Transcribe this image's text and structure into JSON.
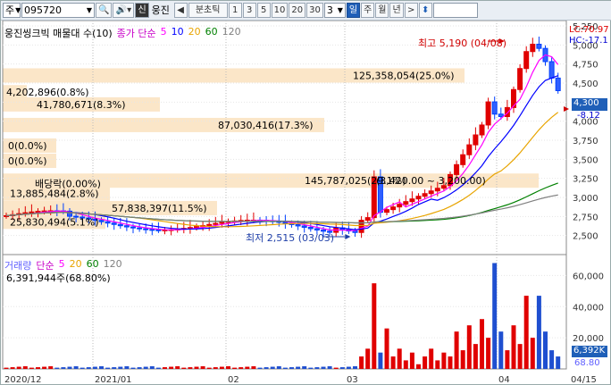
{
  "toolbar": {
    "market": "주",
    "code": "095720",
    "search_icon": "search-icon",
    "speaker_icon": "speaker-icon",
    "credit_badge": "신",
    "stock_name": "웅진",
    "interval_label": "분초틱",
    "intervals": [
      "1",
      "3",
      "5",
      "10",
      "20",
      "30"
    ],
    "count_value": "3",
    "periods": [
      "일",
      "주",
      "월",
      "년"
    ],
    "next_arrow": ">",
    "updown_icon": "up-down-icon"
  },
  "price_legend": {
    "series_title": "웅진씽크빅 매물대 수(10)",
    "ma_title": "종가 단순",
    "periods": [
      {
        "label": "5",
        "color": "#ff00ff"
      },
      {
        "label": "10",
        "color": "#0000ff"
      },
      {
        "label": "20",
        "color": "#e8a400"
      },
      {
        "label": "60",
        "color": "#008000"
      },
      {
        "label": "120",
        "color": "#808080"
      }
    ]
  },
  "volume_legend": {
    "title": "거래량",
    "ma_title": "단순",
    "periods": [
      {
        "label": "5",
        "color": "#ff00ff"
      },
      {
        "label": "20",
        "color": "#e8a400"
      },
      {
        "label": "60",
        "color": "#008000"
      },
      {
        "label": "120",
        "color": "#808080"
      }
    ],
    "max_volume_label": "6,391,944주(68.80%)"
  },
  "right_panel": {
    "lc_label": "LC:70.97",
    "hc_label": "HC:-17.1",
    "current_price": "4,300",
    "change": "-8.12",
    "volume_current": "6,392K",
    "volume_pct": "68.80"
  },
  "annotations": {
    "high": "최고 5,190 (04/08)",
    "low": "최저 2,515 (03/03)"
  },
  "chart_data": [
    {
      "type": "candlestick",
      "title": "웅진씽크빅 매물대 수(10)",
      "ylim": [
        2250,
        5250
      ],
      "y_ticks": [
        2500,
        2750,
        3000,
        3250,
        3500,
        3750,
        4000,
        4250,
        4500,
        4750,
        5000,
        5250
      ],
      "y_tick_labels": [
        "2,500",
        "2,750",
        "3,000",
        "3,250",
        "3,500",
        "3,750",
        "4,000",
        "4,250",
        "4,500",
        "4,750",
        "5,000",
        "5,250"
      ],
      "x_labels": [
        "2020/12",
        "2021/01",
        "02",
        "03",
        "04",
        "04/15"
      ],
      "high": {
        "price": 5190,
        "date": "04/08"
      },
      "low": {
        "price": 2515,
        "date": "03/03"
      },
      "last_price": 4300,
      "volume_profile": [
        {
          "price": 4600,
          "label": "125,358,054(25.0%)"
        },
        {
          "price": 4380,
          "label": "4,202,896(0.8%)"
        },
        {
          "price": 4220,
          "label": "41,780,671(8.3%)"
        },
        {
          "price": 3950,
          "label": "87,030,416(17.3%)"
        },
        {
          "price": 3680,
          "label": "0(0.0%)"
        },
        {
          "price": 3480,
          "label": "0(0.0%)"
        },
        {
          "price": 3220,
          "label": "145,787,025(29.1%)"
        },
        {
          "price": 3220,
          "label": "(3,420.00 ~ 3,200.00)"
        },
        {
          "price": 3180,
          "label": "배당락(0.00%)"
        },
        {
          "price": 3050,
          "label": "13,885,484(2.8%)"
        },
        {
          "price": 2860,
          "label": "57,838,397(11.5%)"
        },
        {
          "price": 2680,
          "label": "25,830,494(5.1%)"
        }
      ]
    },
    {
      "type": "bar",
      "title": "거래량",
      "ylim": [
        0,
        70000
      ],
      "y_ticks": [
        20000,
        40000,
        60000
      ],
      "y_tick_labels": [
        "20,000",
        "40,000",
        "60,000"
      ]
    }
  ]
}
